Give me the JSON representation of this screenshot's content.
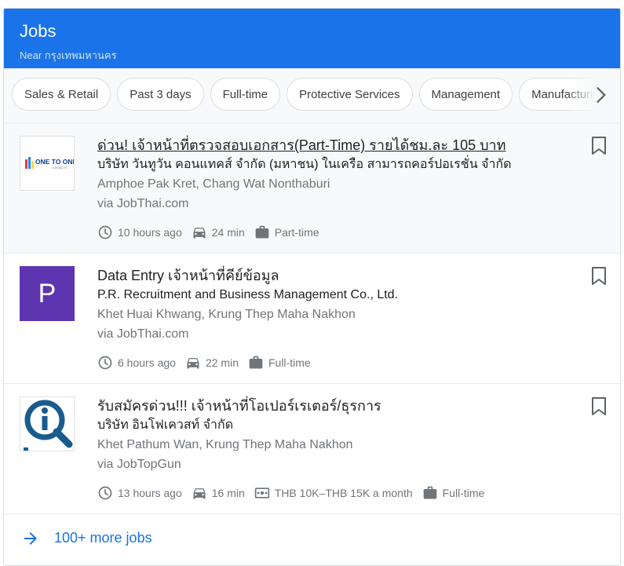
{
  "header": {
    "title": "Jobs",
    "subtitle": "Near กรุงเทพมหานคร",
    "color": "#1a73e8"
  },
  "filters": {
    "chips": [
      "Sales & Retail",
      "Past 3 days",
      "Full-time",
      "Protective Services",
      "Management",
      "Manufacturing"
    ],
    "next_icon": "chevron-right-icon"
  },
  "jobs": [
    {
      "title": "ด่วน! เจ้าหน้าที่ตรวจสอบเอกสาร(Part-Time) รายได้ชม.ละ 105 บาท",
      "company": "บริษัท วันทูวัน คอนแทคส์ จำกัด (มหาชน) ในเครือ สามารถคอร์ปอเรชั่น จำกัด",
      "location": "Amphoe Pak Kret, Chang Wat Nonthaburi",
      "via": "via JobThai.com",
      "posted": "10 hours ago",
      "commute": "24 min",
      "type": "Part-time",
      "logo_text": "ONE TO ONE",
      "logo_sub": "CONTACTS"
    },
    {
      "title": "Data Entry เจ้าหน้าที่คีย์ข้อมูล",
      "company": "P.R. Recruitment and Business Management Co., Ltd.",
      "location": "Khet Huai Khwang, Krung Thep Maha Nakhon",
      "via": "via JobThai.com",
      "posted": "6 hours ago",
      "commute": "22 min",
      "type": "Full-time",
      "logo_letter": "P"
    },
    {
      "title": "รับสมัครด่วน!!! เจ้าหน้าที่โอเปอร์เรเตอร์/ธุรการ",
      "company": "บริษัท อินโฟเควสท์ จำกัด",
      "location": "Khet Pathum Wan, Krung Thep Maha Nakhon",
      "via": "via JobTopGun",
      "posted": "13 hours ago",
      "commute": "16 min",
      "salary": "THB 10K–THB 15K a month",
      "type": "Full-time"
    }
  ],
  "more": {
    "label": "100+ more jobs"
  }
}
